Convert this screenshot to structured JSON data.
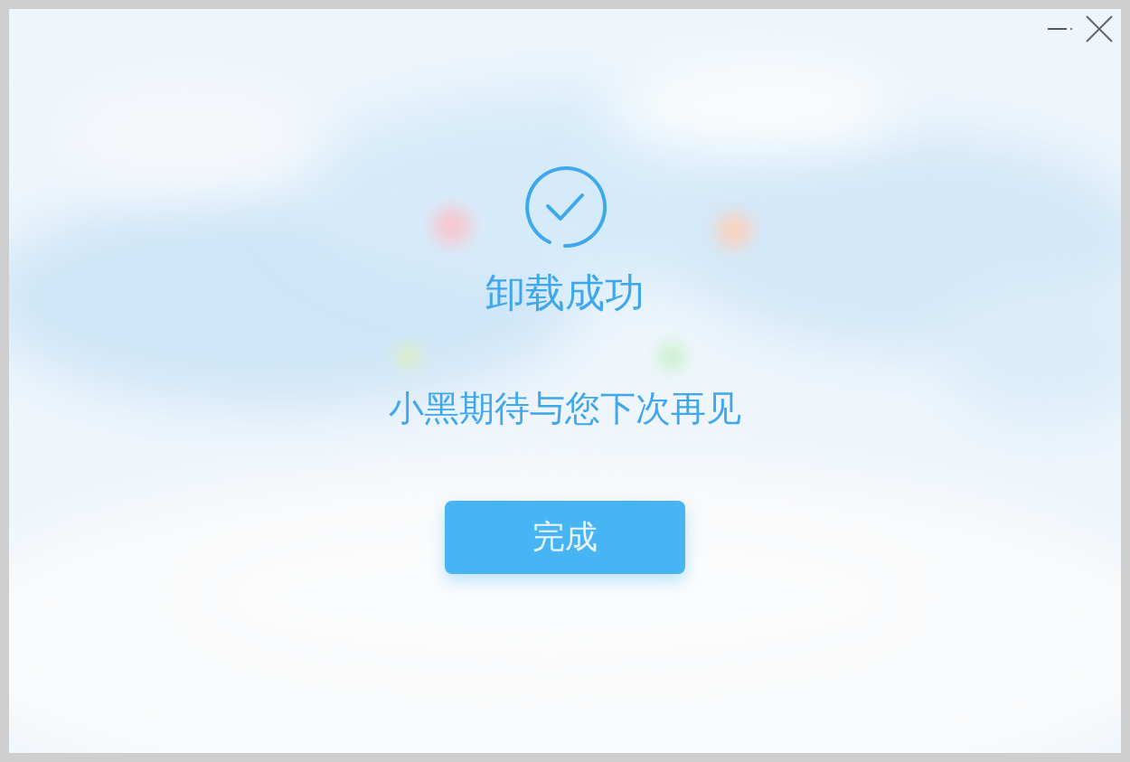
{
  "title": "卸载成功",
  "message": "小黑期待与您下次再见",
  "buttons": [
    {
      "label": "完成"
    }
  ]
}
